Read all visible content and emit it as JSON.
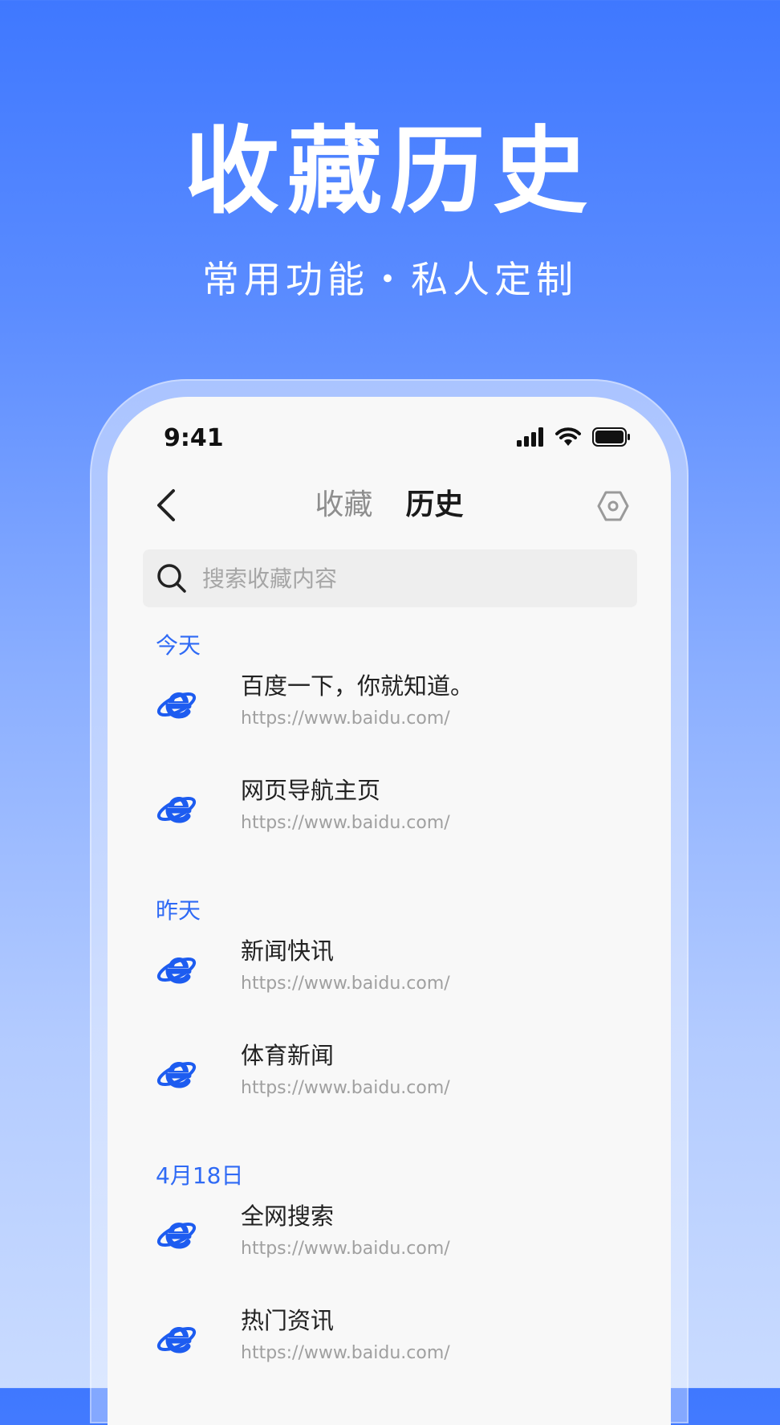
{
  "hero": {
    "title": "收藏历史",
    "subtitle": "常用功能・私人定制"
  },
  "status_bar": {
    "time": "9:41",
    "icons": [
      "signal-icon",
      "wifi-icon",
      "battery-icon"
    ]
  },
  "nav": {
    "back_icon": "chevron-left-icon",
    "tabs": [
      {
        "label": "收藏",
        "active": false
      },
      {
        "label": "历史",
        "active": true
      }
    ],
    "settings_icon": "gear-icon"
  },
  "search": {
    "placeholder": "搜索收藏内容",
    "value": ""
  },
  "sections": [
    {
      "title": "今天",
      "items": [
        {
          "title": "百度一下，你就知道。",
          "url": "https://www.baidu.com/"
        },
        {
          "title": "网页导航主页",
          "url": "https://www.baidu.com/"
        }
      ]
    },
    {
      "title": "昨天",
      "items": [
        {
          "title": "新闻快讯",
          "url": "https://www.baidu.com/"
        },
        {
          "title": "体育新闻",
          "url": "https://www.baidu.com/"
        }
      ]
    },
    {
      "title": "4月18日",
      "items": [
        {
          "title": "全网搜索",
          "url": "https://www.baidu.com/"
        },
        {
          "title": "热门资讯",
          "url": "https://www.baidu.com/"
        }
      ]
    }
  ],
  "colors": {
    "accent": "#2f6af5",
    "browser_icon": "#1d5cf0"
  }
}
